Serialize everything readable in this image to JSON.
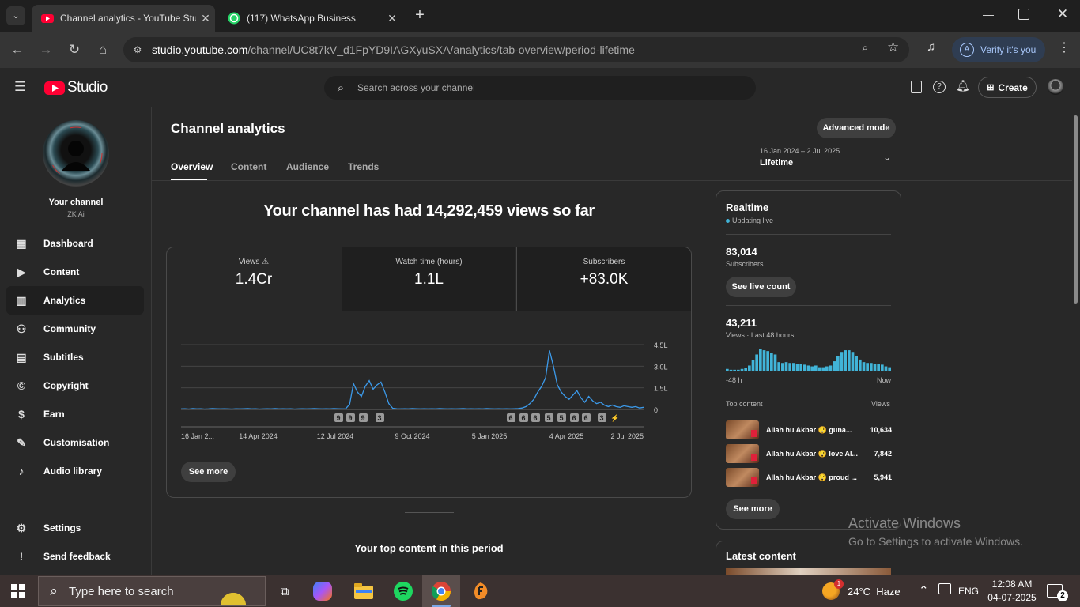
{
  "browser": {
    "tabs": [
      {
        "title": "Channel analytics - YouTube Stu",
        "icon": "youtube-icon"
      },
      {
        "title": "(117) WhatsApp Business",
        "icon": "whatsapp-icon"
      }
    ],
    "url_host": "studio.youtube.com",
    "url_path": "/channel/UC8t7kV_d1FpYD9IAGXyuSXA/analytics/tab-overview/period-lifetime",
    "verify_label": "Verify it's you",
    "verify_avatar": "A"
  },
  "studio": {
    "logo_text": "Studio",
    "search_placeholder": "Search across your channel",
    "create_label": "Create"
  },
  "sidebar": {
    "channel_title": "Your channel",
    "channel_name": "ZK Ai",
    "items": [
      {
        "label": "Dashboard",
        "icon": "dashboard-icon"
      },
      {
        "label": "Content",
        "icon": "content-icon"
      },
      {
        "label": "Analytics",
        "icon": "analytics-icon",
        "active": true
      },
      {
        "label": "Community",
        "icon": "community-icon"
      },
      {
        "label": "Subtitles",
        "icon": "subtitles-icon"
      },
      {
        "label": "Copyright",
        "icon": "copyright-icon"
      },
      {
        "label": "Earn",
        "icon": "earn-icon"
      },
      {
        "label": "Customisation",
        "icon": "customisation-icon"
      },
      {
        "label": "Audio library",
        "icon": "audio-library-icon"
      }
    ],
    "settings_label": "Settings",
    "feedback_label": "Send feedback"
  },
  "analytics": {
    "page_title": "Channel analytics",
    "advanced_label": "Advanced mode",
    "tabs": [
      "Overview",
      "Content",
      "Audience",
      "Trends"
    ],
    "period_range": "16 Jan 2024 – 2 Jul 2025",
    "period_label": "Lifetime",
    "headline": "Your channel has had 14,292,459 views so far",
    "metrics": [
      {
        "label": "Views",
        "value": "1.4Cr"
      },
      {
        "label": "Watch time (hours)",
        "value": "1.1L"
      },
      {
        "label": "Subscribers",
        "value": "+83.0K"
      }
    ],
    "see_more": "See more",
    "top_content_heading": "Your top content in this period"
  },
  "chart_data": [
    {
      "type": "line",
      "x": [
        "16 Jan 2...",
        "14 Apr 2024",
        "12 Jul 2024",
        "9 Oct 2024",
        "5 Jan 2025",
        "4 Apr 2025",
        "2 Jul 2025"
      ],
      "y_tick_labels": [
        "4.5L",
        "3.0L",
        "1.5L",
        "0"
      ],
      "series": [
        {
          "values": [
            0.04,
            0.05,
            0.03,
            0.06,
            0.04,
            0.05,
            0.03,
            0.04,
            0.06,
            0.05,
            0.04,
            0.05,
            0.04,
            0.03,
            0.05,
            0.04,
            0.05,
            0.06,
            0.04,
            0.05,
            0.03,
            0.04,
            0.05,
            0.04,
            0.06,
            0.04,
            0.05,
            0.04,
            0.05,
            0.03,
            0.04,
            0.05,
            0.04,
            0.05,
            0.06,
            0.05,
            0.04,
            0.05,
            0.04,
            0.06,
            0.05,
            0.04,
            0.05,
            0.35,
            1.8,
            1.2,
            0.9,
            1.6,
            2.0,
            1.4,
            1.7,
            1.9,
            1.2,
            0.4,
            0.08,
            0.05,
            0.04,
            0.05,
            0.04,
            0.06,
            0.05,
            0.04,
            0.05,
            0.04,
            0.05,
            0.04,
            0.06,
            0.05,
            0.04,
            0.05,
            0.04,
            0.05,
            0.06,
            0.04,
            0.05,
            0.04,
            0.05,
            0.04,
            0.06,
            0.05,
            0.04,
            0.05,
            0.04,
            0.05,
            0.04,
            0.05,
            0.06,
            0.1,
            0.2,
            0.4,
            0.7,
            1.2,
            1.6,
            2.2,
            4.1,
            3.0,
            1.7,
            1.2,
            0.9,
            0.7,
            1.0,
            1.3,
            0.8,
            0.5,
            0.9,
            0.6,
            0.4,
            0.5,
            0.3,
            0.2,
            0.3,
            0.2,
            0.15,
            0.25,
            0.2,
            0.15,
            0.2,
            0.1,
            0.15
          ]
        }
      ],
      "ylim": [
        0,
        4.5
      ],
      "markers": [
        "9",
        "9",
        "9",
        "3",
        "6",
        "6",
        "6",
        "5",
        "5",
        "6",
        "6",
        "3",
        "⚡"
      ]
    },
    {
      "type": "bar",
      "title": "Views · Last 48 hours",
      "x_tick_labels": [
        "-48 h",
        "Now"
      ],
      "values": [
        3,
        2,
        2,
        2,
        3,
        4,
        7,
        13,
        20,
        26,
        25,
        24,
        22,
        20,
        11,
        10,
        11,
        10,
        10,
        9,
        9,
        8,
        7,
        6,
        7,
        5,
        5,
        6,
        7,
        12,
        18,
        23,
        25,
        25,
        23,
        18,
        14,
        11,
        10,
        10,
        9,
        9,
        8,
        6,
        5
      ]
    }
  ],
  "realtime": {
    "title": "Realtime",
    "updating": "Updating live",
    "subscribers_value": "83,014",
    "subscribers_label": "Subscribers",
    "live_count_label": "See live count",
    "views_value": "43,211",
    "views_label": "Views · Last 48 hours",
    "axis_start": "-48 h",
    "axis_end": "Now",
    "top_content_label": "Top content",
    "views_col": "Views",
    "top_content": [
      {
        "title": "Allah hu Akbar 😲 guna...",
        "views": "10,634"
      },
      {
        "title": "Allah hu Akbar 😲 love Al...",
        "views": "7,842"
      },
      {
        "title": "Allah hu Akbar 😲 proud ...",
        "views": "5,941"
      }
    ],
    "see_more": "See more",
    "latest_title": "Latest content"
  },
  "watermark": {
    "line1": "Activate Windows",
    "line2": "Go to Settings to activate Windows."
  },
  "taskbar": {
    "search_placeholder": "Type here to search",
    "weather": "24°C  Haze",
    "weather_badge": "1",
    "lang": "ENG",
    "time": "12:08 AM",
    "date": "04-07-2025",
    "notif_count": "2"
  }
}
